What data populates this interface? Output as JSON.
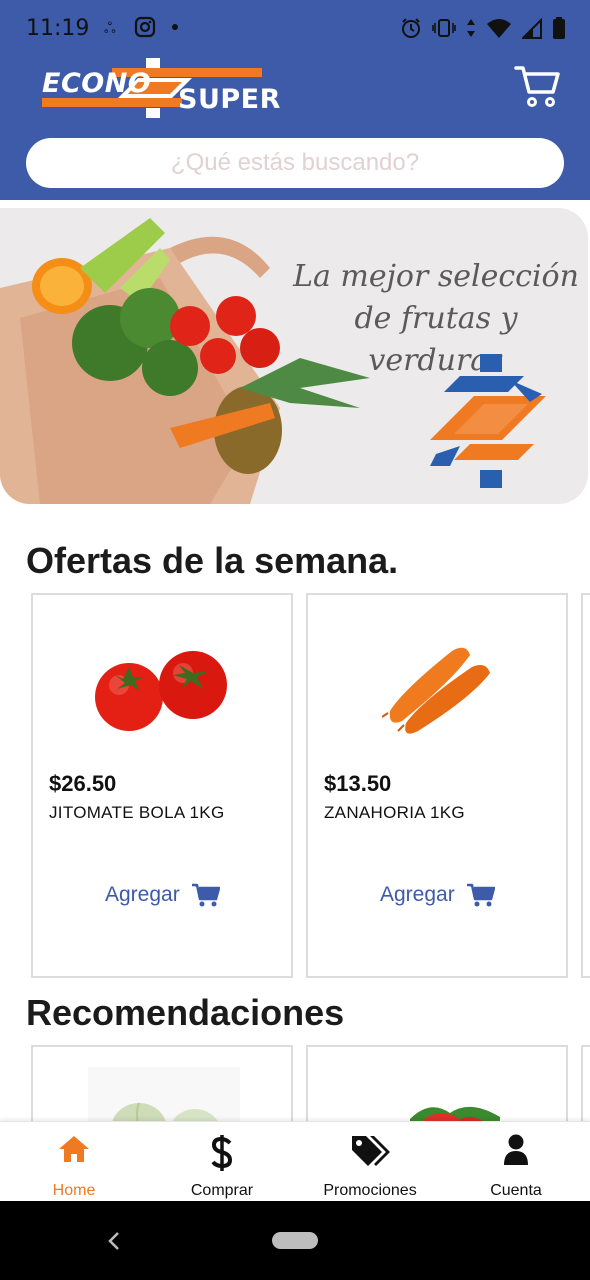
{
  "status_bar": {
    "time": "11:19",
    "icons": [
      "sim-icon",
      "instagram-icon",
      "dot-icon",
      "alarm-icon",
      "vibrate-icon",
      "data-arrows-icon",
      "wifi-icon",
      "signal-icon",
      "battery-icon"
    ]
  },
  "header": {
    "logo_word1": "ECONO",
    "logo_word2": "SUPER",
    "cart_icon": "cart-icon",
    "search_placeholder": "¿Qué estás buscando?"
  },
  "banner": {
    "tagline": "La mejor selección de frutas y verduras"
  },
  "sections": {
    "offers_title": "Ofertas de la semana.",
    "recommendations_title": "Recomendaciones"
  },
  "offers": [
    {
      "price": "$26.50",
      "name": "JITOMATE BOLA 1KG",
      "add_label": "Agregar",
      "image": "tomato"
    },
    {
      "price": "$13.50",
      "name": "ZANAHORIA 1KG",
      "add_label": "Agregar",
      "image": "carrot"
    }
  ],
  "recommendations": [
    {
      "image": "onion"
    },
    {
      "image": "strawberry"
    }
  ],
  "bottom_nav": {
    "items": [
      {
        "label": "Home",
        "icon": "home-icon",
        "active": true
      },
      {
        "label": "Comprar",
        "icon": "dollar-icon",
        "active": false
      },
      {
        "label": "Promociones",
        "icon": "tags-icon",
        "active": false
      },
      {
        "label": "Cuenta",
        "icon": "user-icon",
        "active": false
      }
    ]
  },
  "colors": {
    "brand_blue": "#3d5ba9",
    "brand_orange": "#f07a22",
    "text_dark": "#1b1b1b"
  }
}
